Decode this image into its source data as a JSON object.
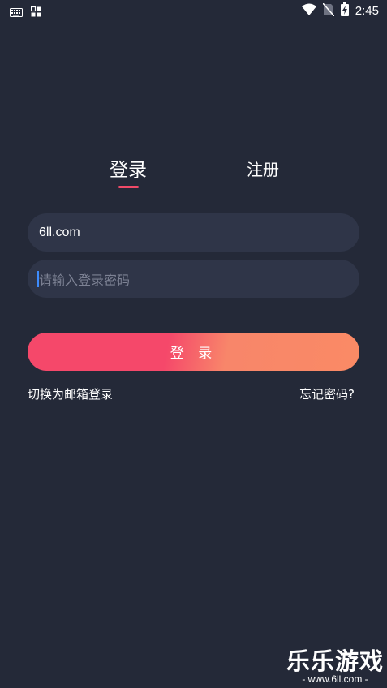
{
  "status_bar": {
    "time": "2:45",
    "icons": [
      "keyboard-icon",
      "app-grid-icon",
      "wifi-icon",
      "no-sim-icon",
      "battery-charging-icon"
    ]
  },
  "tabs": [
    {
      "label": "登录",
      "active": true
    },
    {
      "label": "注册",
      "active": false
    }
  ],
  "form": {
    "account_value": "6ll.com",
    "password_placeholder": "请输入登录密码",
    "login_button_label": "登 录"
  },
  "links": {
    "switch_email": "切换为邮箱登录",
    "forgot_password": "忘记密码?"
  },
  "watermark": {
    "title": "乐乐游戏",
    "url": "- www.6ll.com -"
  },
  "colors": {
    "background": "#242938",
    "input_background": "#2f3548",
    "accent": "#f04a68",
    "button_gradient_start": "#f5486a",
    "button_gradient_end": "#fa8a65"
  }
}
